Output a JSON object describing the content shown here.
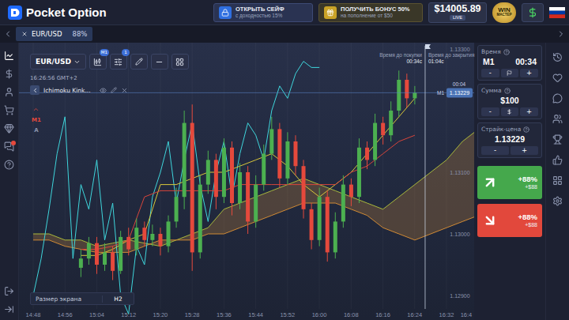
{
  "header": {
    "logo": "Pocket Option",
    "safe": {
      "title": "ОТКРЫТЬ СЕЙФ",
      "subtitle": "с доходностью 15%"
    },
    "bonus": {
      "title": "ПОЛУЧИТЬ БОНУС 50%",
      "subtitle": "на пополнение от $50"
    },
    "balance": {
      "amount": "$14005.89",
      "mode": "LIVE"
    },
    "rank": {
      "title": "WIN",
      "subtitle": "МАСТЕР"
    }
  },
  "tabs": [
    {
      "label": "EUR/USD",
      "payout": "88%",
      "selected": true
    }
  ],
  "sidebar": {
    "items": [
      {
        "selected": true,
        "badge": false
      },
      {
        "selected": false,
        "badge": false
      },
      {
        "selected": false,
        "badge": false
      },
      {
        "selected": false,
        "badge": false
      },
      {
        "selected": false,
        "badge": false
      },
      {
        "selected": false,
        "badge": true
      },
      {
        "selected": false,
        "badge": false
      }
    ],
    "footer": [
      {
        "selected": false,
        "badge": false
      },
      {
        "selected": false,
        "badge": false
      }
    ]
  },
  "chart": {
    "symbol": "EUR/USD",
    "timeframe": "M1",
    "indicator_count": "1",
    "clock": "16:26:56 GMT+2",
    "indicator": "Ichimoku Kink...",
    "tool_labels": [
      "M1",
      "A"
    ],
    "screen_size": {
      "label": "Размер экрана",
      "value": "H2"
    },
    "purchase": {
      "label": "Время до покупки",
      "value": "00:34с"
    },
    "expiry": {
      "label": "Время до закрытия",
      "value": "01:04с"
    },
    "price_axis": {
      "ticks": [
        "1.13300",
        "1.13100",
        "1.13000",
        "1.12900"
      ],
      "current": "1.13229",
      "current_timeframe": "M1",
      "countdown": "00:04"
    },
    "time_axis": {
      "ticks": [
        "14:48",
        "14:56",
        "15:04",
        "15:12",
        "15:20",
        "15:28",
        "15:36",
        "15:44",
        "15:52",
        "16:00",
        "16:08",
        "16:16",
        "16:24",
        "16:32",
        "16:4"
      ]
    },
    "candles": {
      "start_minute": 12,
      "step_minutes": 2,
      "values": [
        {
          "o": 1.12945,
          "h": 1.12975,
          "l": 1.1293,
          "c": 1.1296
        },
        {
          "o": 1.1296,
          "h": 1.12995,
          "l": 1.1295,
          "c": 1.12985
        },
        {
          "o": 1.12985,
          "h": 1.12995,
          "l": 1.12935,
          "c": 1.1295
        },
        {
          "o": 1.1295,
          "h": 1.12985,
          "l": 1.1294,
          "c": 1.1297
        },
        {
          "o": 1.1297,
          "h": 1.1298,
          "l": 1.12925,
          "c": 1.1294
        },
        {
          "o": 1.1294,
          "h": 1.13005,
          "l": 1.12935,
          "c": 1.12995
        },
        {
          "o": 1.12995,
          "h": 1.1301,
          "l": 1.12965,
          "c": 1.12975
        },
        {
          "o": 1.12975,
          "h": 1.13025,
          "l": 1.12965,
          "c": 1.1301
        },
        {
          "o": 1.1301,
          "h": 1.1302,
          "l": 1.1298,
          "c": 1.1299
        },
        {
          "o": 1.1299,
          "h": 1.13015,
          "l": 1.1298,
          "c": 1.13
        },
        {
          "o": 1.13,
          "h": 1.1301,
          "l": 1.12965,
          "c": 1.1298
        },
        {
          "o": 1.1298,
          "h": 1.1303,
          "l": 1.1297,
          "c": 1.1302
        },
        {
          "o": 1.1302,
          "h": 1.13075,
          "l": 1.1301,
          "c": 1.1306
        },
        {
          "o": 1.1306,
          "h": 1.132,
          "l": 1.1304,
          "c": 1.1318
        },
        {
          "o": 1.1318,
          "h": 1.1321,
          "l": 1.1294,
          "c": 1.1297
        },
        {
          "o": 1.1297,
          "h": 1.13095,
          "l": 1.1296,
          "c": 1.1308
        },
        {
          "o": 1.1308,
          "h": 1.13135,
          "l": 1.13065,
          "c": 1.1312
        },
        {
          "o": 1.1312,
          "h": 1.1313,
          "l": 1.1304,
          "c": 1.1306
        },
        {
          "o": 1.1306,
          "h": 1.13155,
          "l": 1.1305,
          "c": 1.1314
        },
        {
          "o": 1.1314,
          "h": 1.1315,
          "l": 1.1303,
          "c": 1.1305
        },
        {
          "o": 1.1305,
          "h": 1.13115,
          "l": 1.1304,
          "c": 1.131
        },
        {
          "o": 1.131,
          "h": 1.1311,
          "l": 1.13,
          "c": 1.1302
        },
        {
          "o": 1.1302,
          "h": 1.13095,
          "l": 1.1301,
          "c": 1.1308
        },
        {
          "o": 1.1308,
          "h": 1.13145,
          "l": 1.1307,
          "c": 1.1313
        },
        {
          "o": 1.1313,
          "h": 1.1319,
          "l": 1.1312,
          "c": 1.1317
        },
        {
          "o": 1.1317,
          "h": 1.1318,
          "l": 1.13075,
          "c": 1.1309
        },
        {
          "o": 1.1309,
          "h": 1.13165,
          "l": 1.1308,
          "c": 1.1315
        },
        {
          "o": 1.1315,
          "h": 1.1316,
          "l": 1.13095,
          "c": 1.1311
        },
        {
          "o": 1.1311,
          "h": 1.1312,
          "l": 1.13025,
          "c": 1.1304
        },
        {
          "o": 1.1304,
          "h": 1.1305,
          "l": 1.12975,
          "c": 1.1299
        },
        {
          "o": 1.1299,
          "h": 1.13075,
          "l": 1.1298,
          "c": 1.1306
        },
        {
          "o": 1.1306,
          "h": 1.1307,
          "l": 1.12955,
          "c": 1.1297
        },
        {
          "o": 1.1297,
          "h": 1.13035,
          "l": 1.1296,
          "c": 1.1302
        },
        {
          "o": 1.1302,
          "h": 1.13095,
          "l": 1.1301,
          "c": 1.1308
        },
        {
          "o": 1.1308,
          "h": 1.1309,
          "l": 1.13045,
          "c": 1.1306
        },
        {
          "o": 1.1306,
          "h": 1.13155,
          "l": 1.1305,
          "c": 1.1314
        },
        {
          "o": 1.1314,
          "h": 1.1315,
          "l": 1.13105,
          "c": 1.1312
        },
        {
          "o": 1.1312,
          "h": 1.13195,
          "l": 1.1311,
          "c": 1.1318
        },
        {
          "o": 1.1318,
          "h": 1.1319,
          "l": 1.13145,
          "c": 1.1316
        },
        {
          "o": 1.1316,
          "h": 1.13215,
          "l": 1.1315,
          "c": 1.132
        },
        {
          "o": 1.132,
          "h": 1.13265,
          "l": 1.1319,
          "c": 1.1325
        },
        {
          "o": 1.1325,
          "h": 1.1326,
          "l": 1.13205,
          "c": 1.1322
        },
        {
          "o": 1.1322,
          "h": 1.1324,
          "l": 1.1321,
          "c": 1.13229
        }
      ]
    },
    "lines": [
      {
        "color": "#3fd6dc",
        "start_minute": 0,
        "step_minutes": 2,
        "values": [
          1.129,
          1.1296,
          1.1304,
          1.1313,
          1.1319,
          1.1296,
          1.1308,
          1.1304,
          1.1312,
          1.1299,
          1.1305,
          1.129,
          1.1287,
          1.1298,
          1.1295,
          1.1306,
          1.131,
          1.1315,
          1.1305,
          1.1312,
          1.1318,
          1.1308,
          1.1302,
          1.131,
          1.1315,
          1.1306,
          1.1313,
          1.1318,
          1.1316,
          1.1312,
          1.132,
          1.1324,
          1.1322,
          1.1326,
          1.1328,
          1.1327,
          1.1327
        ]
      },
      {
        "color": "#d9c73a",
        "start_minute": 12,
        "step_minutes": 4,
        "values": [
          1.12965,
          1.12965,
          1.12975,
          1.1299,
          1.13,
          1.1308,
          1.1308,
          1.1309,
          1.131,
          1.131,
          1.1311,
          1.1312,
          1.1313,
          1.1311,
          1.1308,
          1.1306,
          1.1308,
          1.131,
          1.1313,
          1.1316,
          1.1319,
          1.1322
        ]
      },
      {
        "color": "#d8453b",
        "start_minute": 12,
        "step_minutes": 4,
        "values": [
          1.12975,
          1.12975,
          1.1298,
          1.1299,
          1.1306,
          1.1307,
          1.1307,
          1.1307,
          1.1307,
          1.1307,
          1.1308,
          1.1308,
          1.1308,
          1.1308,
          1.1308,
          1.1308,
          1.1308,
          1.131,
          1.1311,
          1.1313,
          1.1315,
          1.1316
        ]
      }
    ],
    "cloud": {
      "color": "#c98a3a",
      "span_a": {
        "color": "#a9b83c",
        "start_minute": 0,
        "step_minutes": 4,
        "values": [
          1.13,
          1.13,
          1.1299,
          1.1299,
          1.1298,
          1.12985,
          1.1299,
          1.12985,
          1.1298,
          1.1299,
          1.13,
          1.1301,
          1.1304,
          1.1305,
          1.1306,
          1.1307,
          1.1308,
          1.1309,
          1.1308,
          1.1307,
          1.1306,
          1.1305,
          1.1304,
          1.1306,
          1.1308,
          1.131,
          1.1312,
          1.1315,
          1.1317
        ]
      },
      "span_b": {
        "color": "#d08a35",
        "start_minute": 0,
        "step_minutes": 4,
        "values": [
          1.1299,
          1.1299,
          1.1298,
          1.12975,
          1.1297,
          1.1297,
          1.1297,
          1.1298,
          1.1299,
          1.1299,
          1.1299,
          1.13,
          1.13,
          1.1301,
          1.1302,
          1.1303,
          1.1304,
          1.1305,
          1.1305,
          1.1305,
          1.1304,
          1.1303,
          1.1301,
          1.13,
          1.1299,
          1.13,
          1.1301,
          1.1302,
          1.1303
        ]
      }
    }
  },
  "trade": {
    "time": {
      "label": "Время",
      "timeframe": "M1",
      "value": "00:34"
    },
    "amount": {
      "label": "Сумма",
      "value": "$100"
    },
    "strike": {
      "label": "Страйк-цена",
      "value": "1.13229"
    },
    "minus": "-",
    "plus": "+",
    "buy": {
      "payout": "+88%",
      "profit": "+$88"
    },
    "sell": {
      "payout": "+88%",
      "profit": "+$88"
    }
  }
}
